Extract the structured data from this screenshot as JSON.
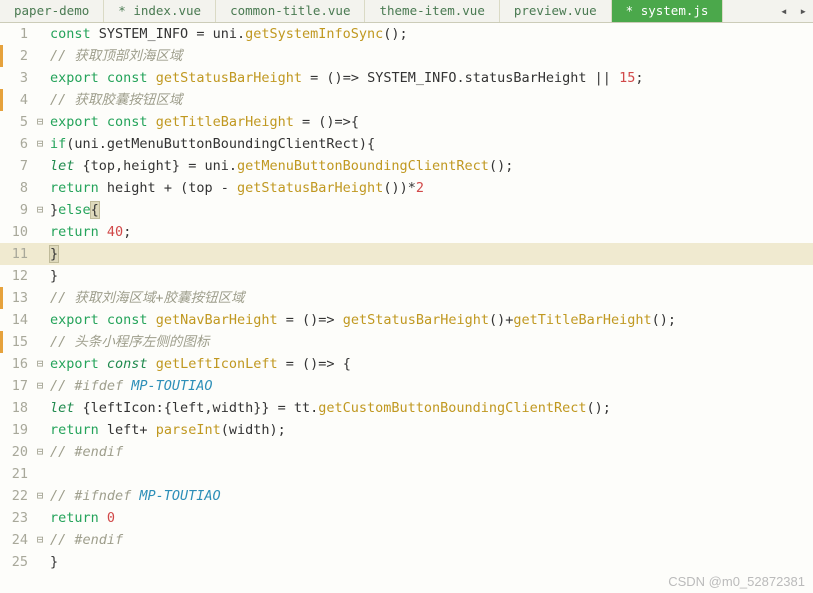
{
  "tabs": {
    "items": [
      {
        "label": "paper-demo",
        "dirty": false,
        "active": false
      },
      {
        "label": "* index.vue",
        "dirty": true,
        "active": false
      },
      {
        "label": "common-title.vue",
        "dirty": false,
        "active": false
      },
      {
        "label": "theme-item.vue",
        "dirty": false,
        "active": false
      },
      {
        "label": "preview.vue",
        "dirty": false,
        "active": false
      },
      {
        "label": "* system.js",
        "dirty": true,
        "active": true
      }
    ],
    "nav_left": "◂",
    "nav_right": "▸"
  },
  "code": {
    "lines": [
      {
        "n": 1,
        "mark": false,
        "fold": "",
        "html": "<span class='kw'>const</span> SYSTEM_INFO <span class='op'>=</span> uni.<span class='fn'>getSystemInfoSync</span>();"
      },
      {
        "n": 2,
        "mark": true,
        "fold": "",
        "html": "<span class='cm'>// 获取顶部刘海区域</span>"
      },
      {
        "n": 3,
        "mark": false,
        "fold": "",
        "html": "<span class='kw'>export</span> <span class='kw'>const</span> <span class='fn'>getStatusBarHeight</span> <span class='op'>=</span> ()<span class='op'>=&gt;</span> SYSTEM_INFO.statusBarHeight <span class='op'>||</span> <span class='num'>15</span>;"
      },
      {
        "n": 4,
        "mark": true,
        "fold": "",
        "html": "<span class='cm'>// 获取胶囊按钮区域</span>"
      },
      {
        "n": 5,
        "mark": false,
        "fold": "⊟",
        "html": "<span class='kw'>export</span> <span class='kw'>const</span> <span class='fn'>getTitleBarHeight</span> <span class='op'>=</span> ()<span class='op'>=&gt;</span>{"
      },
      {
        "n": 6,
        "mark": false,
        "fold": "⊟",
        "html": "    <span class='kw'>if</span>(uni.getMenuButtonBoundingClientRect){"
      },
      {
        "n": 7,
        "mark": false,
        "fold": "",
        "html": "        <span class='kw2'>let</span> {top,height} <span class='op'>=</span> uni.<span class='fn'>getMenuButtonBoundingClientRect</span>();"
      },
      {
        "n": 8,
        "mark": false,
        "fold": "",
        "html": "        <span class='kw'>return</span> height <span class='op'>+</span> (top <span class='op'>-</span> <span class='fn'>getStatusBarHeight</span>())<span class='op'>*</span><span class='num'>2</span>"
      },
      {
        "n": 9,
        "mark": false,
        "fold": "⊟",
        "html": "    }<span class='kw'>else</span><span class='brace-hl'>{</span>",
        "hl": false
      },
      {
        "n": 10,
        "mark": false,
        "fold": "",
        "html": "        <span class='kw'>return</span> <span class='num'>40</span>;"
      },
      {
        "n": 11,
        "mark": false,
        "fold": "",
        "html": "    <span class='brace-hl'>}</span>",
        "hl": true
      },
      {
        "n": 12,
        "mark": false,
        "fold": "",
        "html": "}"
      },
      {
        "n": 13,
        "mark": true,
        "fold": "",
        "html": "<span class='cm'>// 获取刘海区域+胶囊按钮区域</span>"
      },
      {
        "n": 14,
        "mark": false,
        "fold": "",
        "html": "<span class='kw'>export</span> <span class='kw'>const</span>  <span class='fn'>getNavBarHeight</span> <span class='op'>=</span> ()<span class='op'>=&gt;</span> <span class='fn'>getStatusBarHeight</span>()<span class='op'>+</span><span class='fn'>getTitleBarHeight</span>();"
      },
      {
        "n": 15,
        "mark": true,
        "fold": "",
        "html": "<span class='cm'>// 头条小程序左侧的图标</span>"
      },
      {
        "n": 16,
        "mark": false,
        "fold": "⊟",
        "html": "<span class='kw'>export</span> <span class='kw2'>const</span> <span class='fn'>getLeftIconLeft</span> <span class='op'>=</span> ()<span class='op'>=&gt;</span> {"
      },
      {
        "n": 17,
        "mark": false,
        "fold": "⊟",
        "html": "    <span class='cm'>// #ifdef <span class='ty'>MP-TOUTIAO</span></span>"
      },
      {
        "n": 18,
        "mark": false,
        "fold": "",
        "html": "        <span class='kw2'>let</span> {leftIcon:{left,width}}  <span class='op'>=</span> tt.<span class='fn'>getCustomButtonBoundingClientRect</span>();"
      },
      {
        "n": 19,
        "mark": false,
        "fold": "",
        "html": "        <span class='kw'>return</span> left<span class='op'>+</span> <span class='fn'>parseInt</span>(width);"
      },
      {
        "n": 20,
        "mark": false,
        "fold": "⊟",
        "html": "    <span class='cm'>// #endif</span>"
      },
      {
        "n": 21,
        "mark": false,
        "fold": "",
        "html": ""
      },
      {
        "n": 22,
        "mark": false,
        "fold": "⊟",
        "html": "    <span class='cm'>// #ifndef <span class='ty'>MP-TOUTIAO</span></span>"
      },
      {
        "n": 23,
        "mark": false,
        "fold": "",
        "html": "        <span class='kw'>return</span> <span class='num'>0</span>"
      },
      {
        "n": 24,
        "mark": false,
        "fold": "⊟",
        "html": "    <span class='cm'>// #endif</span>"
      },
      {
        "n": 25,
        "mark": false,
        "fold": "",
        "html": "}"
      }
    ]
  },
  "watermark": "CSDN @m0_52872381"
}
